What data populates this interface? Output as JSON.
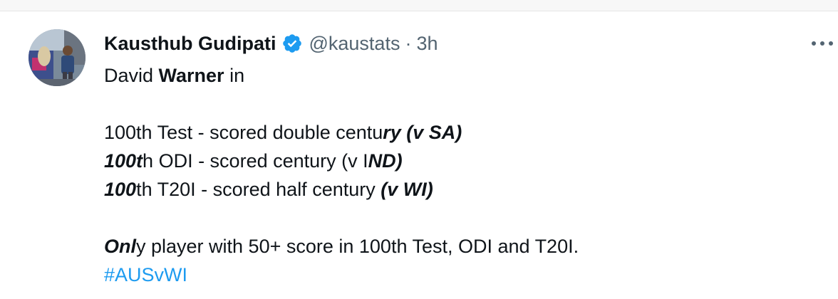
{
  "author": {
    "name": "Kausthub Gudipati",
    "handle": "@kaustats",
    "separator": "·",
    "time": "3h"
  },
  "tweet": {
    "intro": {
      "a": "David ",
      "b": "Warner",
      "c": " in"
    },
    "test_line": {
      "a": "100th Test - scored double centu",
      "b": "ry (v SA)"
    },
    "odi_line": {
      "a": "100t",
      "b": "h ODI - scored century (v I",
      "c": "ND)"
    },
    "t20_line": {
      "a": "100",
      "b": "th T20I - scored half century ",
      "c": "(v WI)"
    },
    "only_line": {
      "a": "Onl",
      "b": "y player with 50+ score in 100th Test, ODI and T20I."
    },
    "hashtag": "#AUSvWI"
  },
  "colors": {
    "verified_badge": "#1d9bf0",
    "hashtag": "#1d9bf0",
    "secondary_text": "#536471"
  },
  "icons": {
    "verified": "verified-badge-icon",
    "more": "more-options-icon"
  }
}
